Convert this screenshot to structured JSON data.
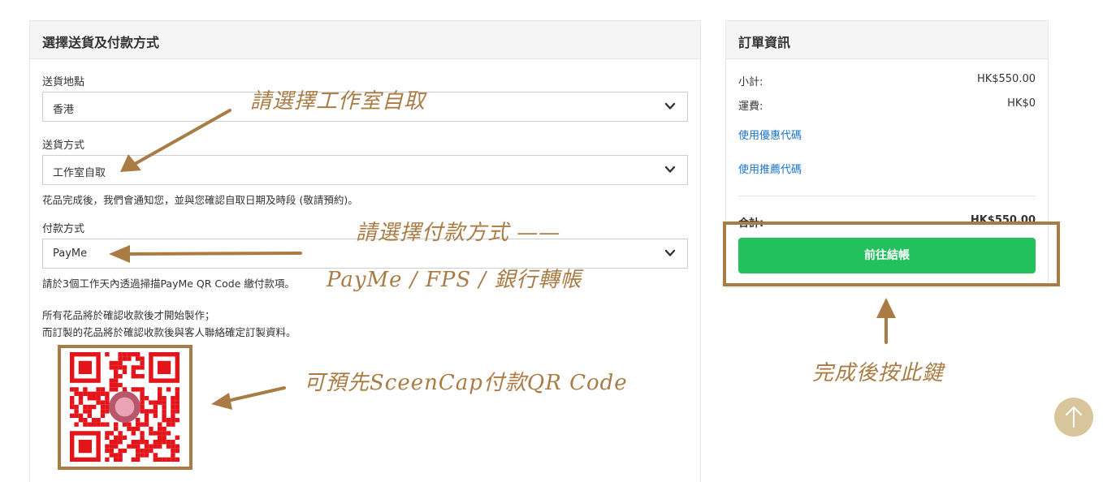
{
  "shipping_payment": {
    "title": "選擇送貨及付款方式",
    "location": {
      "label": "送貨地點",
      "value": "香港"
    },
    "method": {
      "label": "送貨方式",
      "value": "工作室自取",
      "note": "花品完成後，我們會通知您，並與您確認自取日期及時段 (敬請預約)。"
    },
    "payment": {
      "label": "付款方式",
      "value": "PayMe",
      "note": "請於3個工作天內透過掃描PayMe QR Code 繳付款項。"
    },
    "notice_line1": "所有花品將於確認收款後才開始製作；",
    "notice_line2": "而訂製的花品將於確認收款後與客人聯絡確定訂製資料。"
  },
  "order_info": {
    "title": "訂單資訊",
    "subtotal_label": "小計:",
    "subtotal_value": "HK$550.00",
    "shipping_label": "運費:",
    "shipping_value": "HK$0",
    "coupon_link": "使用優惠代碼",
    "referral_link": "使用推薦代碼",
    "total_label": "合計:",
    "total_value": "HK$550.00",
    "checkout_label": "前往結帳"
  },
  "annotations": {
    "pickup": "請選擇工作室自取",
    "payment_method": "請選擇付款方式 ——",
    "payment_options": "PayMe / FPS / 銀行轉帳",
    "qr_hint": "可預先SceenCap付款QR Code",
    "finish_hint": "完成後按此鍵"
  },
  "colors": {
    "annotation": "#a97c45",
    "checkout_button": "#22c15e",
    "link": "#1a73c7",
    "qr": "#e3151b",
    "scroll_button": "#d9c59b"
  },
  "icons": {
    "select_chevron": "chevron-down-icon",
    "scroll_top": "arrow-up-icon",
    "qr": "qr-code-icon"
  }
}
